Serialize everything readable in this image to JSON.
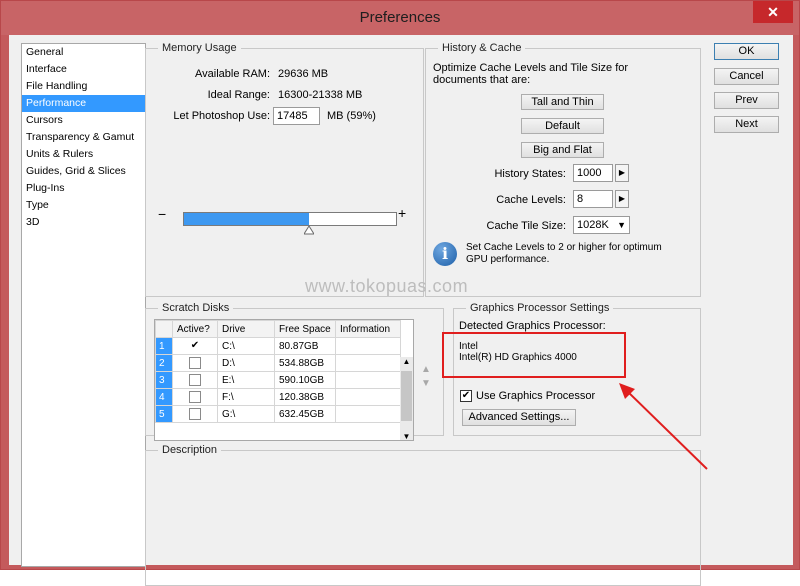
{
  "window": {
    "title": "Preferences",
    "close_glyph": "✕"
  },
  "sidebar": {
    "items": [
      {
        "label": "General"
      },
      {
        "label": "Interface"
      },
      {
        "label": "File Handling"
      },
      {
        "label": "Performance",
        "selected": true
      },
      {
        "label": "Cursors"
      },
      {
        "label": "Transparency & Gamut"
      },
      {
        "label": "Units & Rulers"
      },
      {
        "label": "Guides, Grid & Slices"
      },
      {
        "label": "Plug-Ins"
      },
      {
        "label": "Type"
      },
      {
        "label": "3D"
      }
    ]
  },
  "memory": {
    "legend": "Memory Usage",
    "available_label": "Available RAM:",
    "available_value": "29636 MB",
    "ideal_label": "Ideal Range:",
    "ideal_value": "16300-21338 MB",
    "use_label": "Let Photoshop Use:",
    "use_value": "17485",
    "use_unit": "MB (59%)",
    "slider_fraction": 0.59,
    "minus": "−",
    "plus": "+"
  },
  "history": {
    "legend": "History & Cache",
    "desc": "Optimize Cache Levels and Tile Size for documents that are:",
    "btn_tall": "Tall and Thin",
    "btn_default": "Default",
    "btn_big": "Big and Flat",
    "states_label": "History States:",
    "states_value": "1000",
    "levels_label": "Cache Levels:",
    "levels_value": "8",
    "tile_label": "Cache Tile Size:",
    "tile_value": "1028K",
    "note": "Set Cache Levels to 2 or higher for optimum GPU performance."
  },
  "scratch": {
    "legend": "Scratch Disks",
    "headers": [
      "Active?",
      "Drive",
      "Free Space",
      "Information"
    ],
    "rows": [
      {
        "num": "1",
        "active": true,
        "drive": "C:\\",
        "free": "80.87GB"
      },
      {
        "num": "2",
        "active": false,
        "drive": "D:\\",
        "free": "534.88GB"
      },
      {
        "num": "3",
        "active": false,
        "drive": "E:\\",
        "free": "590.10GB"
      },
      {
        "num": "4",
        "active": false,
        "drive": "F:\\",
        "free": "120.38GB"
      },
      {
        "num": "5",
        "active": false,
        "drive": "G:\\",
        "free": "632.45GB"
      }
    ]
  },
  "gpu": {
    "legend": "Graphics Processor Settings",
    "detected_label": "Detected Graphics Processor:",
    "vendor": "Intel",
    "model": "Intel(R) HD Graphics 4000",
    "use_label": "Use Graphics Processor",
    "use_checked": true,
    "advanced": "Advanced Settings..."
  },
  "description": {
    "legend": "Description"
  },
  "buttons": {
    "ok": "OK",
    "cancel": "Cancel",
    "prev": "Prev",
    "next": "Next"
  },
  "watermark": "www.tokopuas.com",
  "colors": {
    "accent": "#3399ff",
    "title_bar": "#c86466",
    "annotation": "#e01e1e"
  }
}
